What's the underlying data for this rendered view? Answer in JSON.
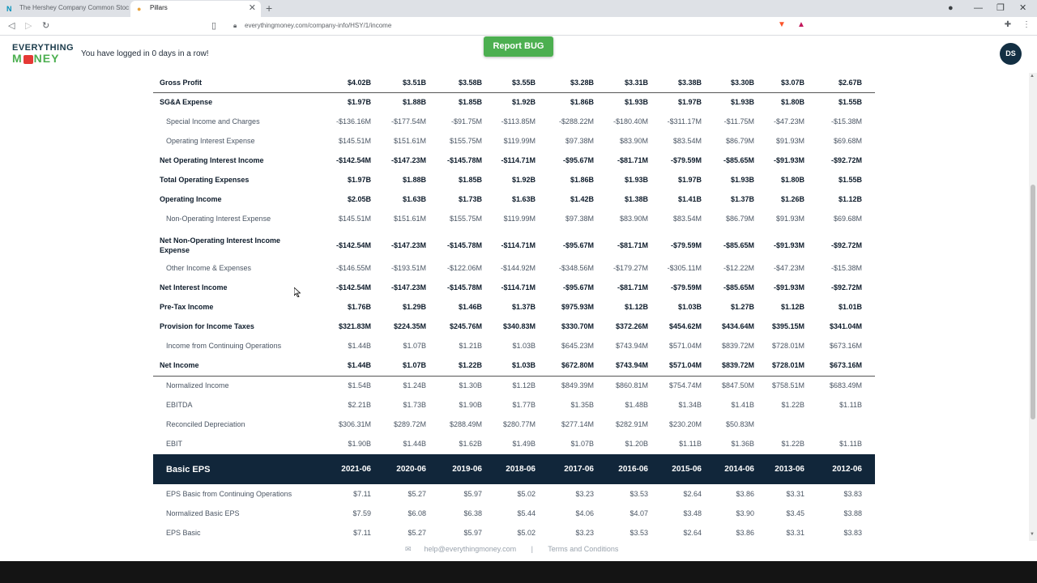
{
  "browser": {
    "tabs": [
      {
        "title": "The Hershey Company Common Stoc",
        "favicon": "N"
      },
      {
        "title": "Pillars",
        "favicon": "●"
      }
    ],
    "url": "everythingmoney.com/company-info/HSY/1/income"
  },
  "header": {
    "logo_line1": "EVERYTHING",
    "logo_line2_a": "M",
    "logo_line2_b": "NEY",
    "streak_text": "You have logged in 0 days in a row!",
    "report_bug_label": "Report BUG",
    "avatar_initials": "DS"
  },
  "rows": [
    {
      "label": "Gross Profit",
      "style": "bold",
      "values": [
        "$4.02B",
        "$3.51B",
        "$3.58B",
        "$3.55B",
        "$3.28B",
        "$3.31B",
        "$3.38B",
        "$3.30B",
        "$3.07B",
        "$2.67B"
      ]
    },
    {
      "label": "SG&A Expense",
      "style": "bold",
      "values": [
        "$1.97B",
        "$1.88B",
        "$1.85B",
        "$1.92B",
        "$1.86B",
        "$1.93B",
        "$1.97B",
        "$1.93B",
        "$1.80B",
        "$1.55B"
      ]
    },
    {
      "label": "Special Income and Charges",
      "style": "sub",
      "values": [
        "-$136.16M",
        "-$177.54M",
        "-$91.75M",
        "-$113.85M",
        "-$288.22M",
        "-$180.40M",
        "-$311.17M",
        "-$11.75M",
        "-$47.23M",
        "-$15.38M"
      ]
    },
    {
      "label": "Operating Interest Expense",
      "style": "sub",
      "values": [
        "$145.51M",
        "$151.61M",
        "$155.75M",
        "$119.99M",
        "$97.38M",
        "$83.90M",
        "$83.54M",
        "$86.79M",
        "$91.93M",
        "$69.68M"
      ]
    },
    {
      "label": "Net Operating Interest Income",
      "style": "bold",
      "values": [
        "-$142.54M",
        "-$147.23M",
        "-$145.78M",
        "-$114.71M",
        "-$95.67M",
        "-$81.71M",
        "-$79.59M",
        "-$85.65M",
        "-$91.93M",
        "-$92.72M"
      ]
    },
    {
      "label": "Total Operating Expenses",
      "style": "bold",
      "values": [
        "$1.97B",
        "$1.88B",
        "$1.85B",
        "$1.92B",
        "$1.86B",
        "$1.93B",
        "$1.97B",
        "$1.93B",
        "$1.80B",
        "$1.55B"
      ]
    },
    {
      "label": "Operating Income",
      "style": "bold",
      "values": [
        "$2.05B",
        "$1.63B",
        "$1.73B",
        "$1.63B",
        "$1.42B",
        "$1.38B",
        "$1.41B",
        "$1.37B",
        "$1.26B",
        "$1.12B"
      ]
    },
    {
      "label": "Non-Operating Interest Expense",
      "style": "sub",
      "values": [
        "$145.51M",
        "$151.61M",
        "$155.75M",
        "$119.99M",
        "$97.38M",
        "$83.90M",
        "$83.54M",
        "$86.79M",
        "$91.93M",
        "$69.68M"
      ]
    },
    {
      "label": "Net Non-Operating Interest Income Expense",
      "style": "bold",
      "values": [
        "-$142.54M",
        "-$147.23M",
        "-$145.78M",
        "-$114.71M",
        "-$95.67M",
        "-$81.71M",
        "-$79.59M",
        "-$85.65M",
        "-$91.93M",
        "-$92.72M"
      ]
    },
    {
      "label": "Other Income & Expenses",
      "style": "sub",
      "values": [
        "-$146.55M",
        "-$193.51M",
        "-$122.06M",
        "-$144.92M",
        "-$348.56M",
        "-$179.27M",
        "-$305.11M",
        "-$12.22M",
        "-$47.23M",
        "-$15.38M"
      ]
    },
    {
      "label": "Net Interest Income",
      "style": "bold",
      "values": [
        "-$142.54M",
        "-$147.23M",
        "-$145.78M",
        "-$114.71M",
        "-$95.67M",
        "-$81.71M",
        "-$79.59M",
        "-$85.65M",
        "-$91.93M",
        "-$92.72M"
      ]
    },
    {
      "label": "Pre-Tax Income",
      "style": "bold",
      "values": [
        "$1.76B",
        "$1.29B",
        "$1.46B",
        "$1.37B",
        "$975.93M",
        "$1.12B",
        "$1.03B",
        "$1.27B",
        "$1.12B",
        "$1.01B"
      ]
    },
    {
      "label": "Provision for Income Taxes",
      "style": "bold",
      "values": [
        "$321.83M",
        "$224.35M",
        "$245.76M",
        "$340.83M",
        "$330.70M",
        "$372.26M",
        "$454.62M",
        "$434.64M",
        "$395.15M",
        "$341.04M"
      ]
    },
    {
      "label": "Income from Continuing Operations",
      "style": "sub",
      "values": [
        "$1.44B",
        "$1.07B",
        "$1.21B",
        "$1.03B",
        "$645.23M",
        "$743.94M",
        "$571.04M",
        "$839.72M",
        "$728.01M",
        "$673.16M"
      ]
    },
    {
      "label": "Net Income",
      "style": "bold",
      "values": [
        "$1.44B",
        "$1.07B",
        "$1.22B",
        "$1.03B",
        "$672.80M",
        "$743.94M",
        "$571.04M",
        "$839.72M",
        "$728.01M",
        "$673.16M"
      ]
    },
    {
      "label": "Normalized Income",
      "style": "sub",
      "values": [
        "$1.54B",
        "$1.24B",
        "$1.30B",
        "$1.12B",
        "$849.39M",
        "$860.81M",
        "$754.74M",
        "$847.50M",
        "$758.51M",
        "$683.49M"
      ]
    },
    {
      "label": "EBITDA",
      "style": "sub",
      "values": [
        "$2.21B",
        "$1.73B",
        "$1.90B",
        "$1.77B",
        "$1.35B",
        "$1.48B",
        "$1.34B",
        "$1.41B",
        "$1.22B",
        "$1.11B"
      ]
    },
    {
      "label": "Reconciled Depreciation",
      "style": "sub",
      "values": [
        "$306.31M",
        "$289.72M",
        "$288.49M",
        "$280.77M",
        "$277.14M",
        "$282.91M",
        "$230.20M",
        "$50.83M",
        "",
        ""
      ]
    },
    {
      "label": "EBIT",
      "style": "sub",
      "values": [
        "$1.90B",
        "$1.44B",
        "$1.62B",
        "$1.49B",
        "$1.07B",
        "$1.20B",
        "$1.11B",
        "$1.36B",
        "$1.22B",
        "$1.11B"
      ]
    }
  ],
  "eps_header": {
    "label": "Basic EPS",
    "years": [
      "2021-06",
      "2020-06",
      "2019-06",
      "2018-06",
      "2017-06",
      "2016-06",
      "2015-06",
      "2014-06",
      "2013-06",
      "2012-06"
    ]
  },
  "eps_rows": [
    {
      "label": "EPS Basic from Continuing Operations",
      "values": [
        "$7.11",
        "$5.27",
        "$5.97",
        "$5.02",
        "$3.23",
        "$3.53",
        "$2.64",
        "$3.86",
        "$3.31",
        "$3.83"
      ]
    },
    {
      "label": "Normalized Basic EPS",
      "values": [
        "$7.59",
        "$6.08",
        "$6.38",
        "$5.44",
        "$4.06",
        "$4.07",
        "$3.48",
        "$3.90",
        "$3.45",
        "$3.88"
      ]
    },
    {
      "label": "EPS Basic",
      "values": [
        "$7.11",
        "$5.27",
        "$5.97",
        "$5.02",
        "$3.23",
        "$3.53",
        "$2.64",
        "$3.86",
        "$3.31",
        "$3.83"
      ]
    }
  ],
  "footer": {
    "email": "help@everythingmoney.com",
    "separator": "|",
    "terms": "Terms and Conditions"
  },
  "colors": {
    "accent_green": "#4caf50",
    "dark_navy": "#11263a"
  }
}
